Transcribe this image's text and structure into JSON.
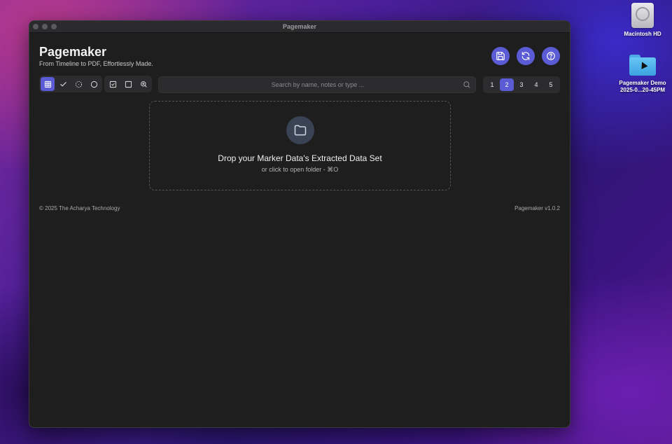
{
  "desktop": {
    "icons": [
      {
        "label": "Macintosh HD",
        "icon": "hard-drive-icon"
      },
      {
        "label_line1": "Pagemaker Demo",
        "label_line2": "2025-0...20-45PM",
        "icon": "folder-icon"
      }
    ]
  },
  "window": {
    "title": "Pagemaker"
  },
  "header": {
    "title": "Pagemaker",
    "subtitle": "From Timeline to PDF, Effortlessly Made."
  },
  "actions": [
    {
      "name": "save",
      "icon": "save-icon"
    },
    {
      "name": "refresh",
      "icon": "refresh-icon"
    },
    {
      "name": "help",
      "icon": "help-icon"
    }
  ],
  "toolbar": {
    "view_tools": [
      "grid-icon",
      "check-icon",
      "dashed-circle-icon",
      "circle-icon"
    ],
    "select_tools": [
      "checkbox-icon",
      "square-icon",
      "zoom-icon"
    ],
    "active_tool": "grid-icon"
  },
  "search": {
    "placeholder": "Search by name, notes or type ..."
  },
  "pagination": {
    "pages": [
      "1",
      "2",
      "3",
      "4",
      "5"
    ],
    "active": "2"
  },
  "dropzone": {
    "title": "Drop your Marker Data's Extracted Data Set",
    "subtitle": "or click to open folder - ⌘O"
  },
  "footer": {
    "copyright": "© 2025 The Acharya Technology",
    "version": "Pagemaker v1.0.2"
  },
  "colors": {
    "accent": "#5b5bd6",
    "window_bg": "#1e1e1e",
    "control_bg": "#2c2c2e"
  }
}
